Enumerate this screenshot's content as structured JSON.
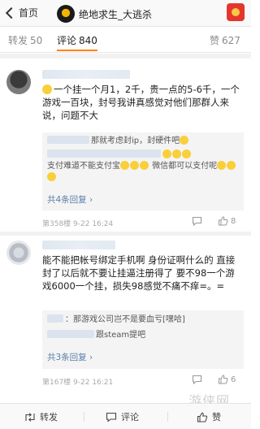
{
  "header": {
    "back_label": "首页",
    "title": "绝地求生_大逃杀"
  },
  "tabs": [
    {
      "label": "转发",
      "count": "50"
    },
    {
      "label": "评论",
      "count": "840"
    },
    {
      "label": "赞",
      "count": "627"
    }
  ],
  "comments": [
    {
      "text_lead": "一个挂一个月1，2千，贵一点的5-6千，一个游戏一百块，封号我讲真感觉对他们那群人来说，问题不大",
      "replies": [
        {
          "text": "那就考虑封ip，封硬件吧"
        },
        {
          "text_a": "支付难道不能支付宝",
          "text_b": "微信都可以支付呢"
        }
      ],
      "more_label": "共4条回复",
      "meta": "第358楼 9-22 16:24",
      "like_count": "8",
      "colors": {
        "accent": "#ff8200"
      }
    },
    {
      "text": "能不能把帐号绑定手机啊 身份证啊什么的 直接封了以后就不要让挂逼注册得了 要不98一个游戏6000一个挂，损失98感觉不痛不痒=。=",
      "replies": [
        {
          "text": "：那游戏公司岂不是要血亏[嘿哈]"
        },
        {
          "text": "跟steam提吧"
        }
      ],
      "more_label": "共3条回复",
      "meta": "第167楼 9-22 16:21",
      "like_count": "6"
    }
  ],
  "bottom_bar": {
    "repost_label": "转发",
    "comment_label": "评论",
    "like_label": "赞"
  },
  "watermark": "游侠网",
  "icons": {
    "back": "chevron-left-icon",
    "reply": "comment-bubble-icon",
    "like": "thumbs-up-icon",
    "repost": "repost-icon"
  }
}
